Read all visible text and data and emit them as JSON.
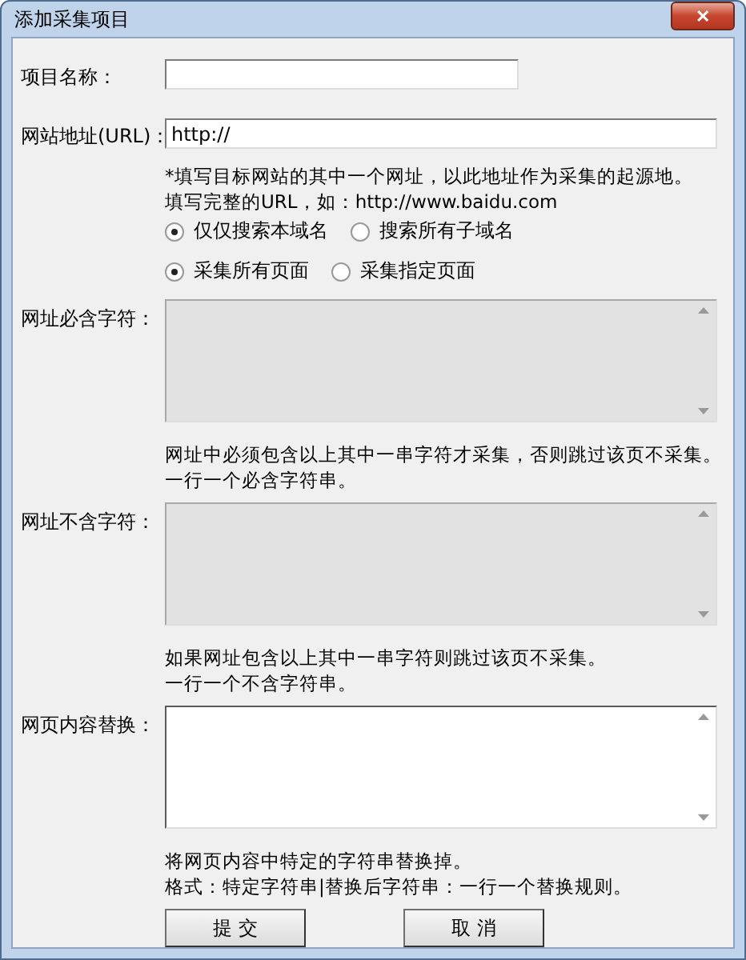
{
  "window": {
    "title": "添加采集项目",
    "close_label": "✕"
  },
  "name_field": {
    "label": "项目名称："
  },
  "url_field": {
    "label": "网站地址(URL)：",
    "value": "http://"
  },
  "url_hints": [
    "*填写目标网站的其中一个网址，以此地址作为采集的起源地。",
    "填写完整的URL，如：http://www.baidu.com"
  ],
  "radio_groups": [
    [
      {
        "label": "仅仅搜索本域名",
        "selected": true
      },
      {
        "label": "搜索所有子域名",
        "selected": false
      }
    ],
    [
      {
        "label": "采集所有页面",
        "selected": true
      },
      {
        "label": "采集指定页面",
        "selected": false
      }
    ]
  ],
  "text_areas": [
    {
      "label": "网址必含字符：",
      "disabled": true,
      "hints": [
        "网址中必须包含以上其中一串字符才采集，否则跳过该页不采集。",
        "一行一个必含字符串。"
      ]
    },
    {
      "label": "网址不含字符：",
      "disabled": true,
      "hints": [
        "如果网址包含以上其中一串字符则跳过该页不采集。",
        "一行一个不含字符串。"
      ]
    },
    {
      "label": "网页内容替换：",
      "disabled": false,
      "hints": [
        "将网页内容中特定的字符串替换掉。",
        "格式：特定字符串|替换后字符串：一行一个替换规则。"
      ]
    }
  ],
  "buttons": [
    "提 交",
    "取 消"
  ]
}
